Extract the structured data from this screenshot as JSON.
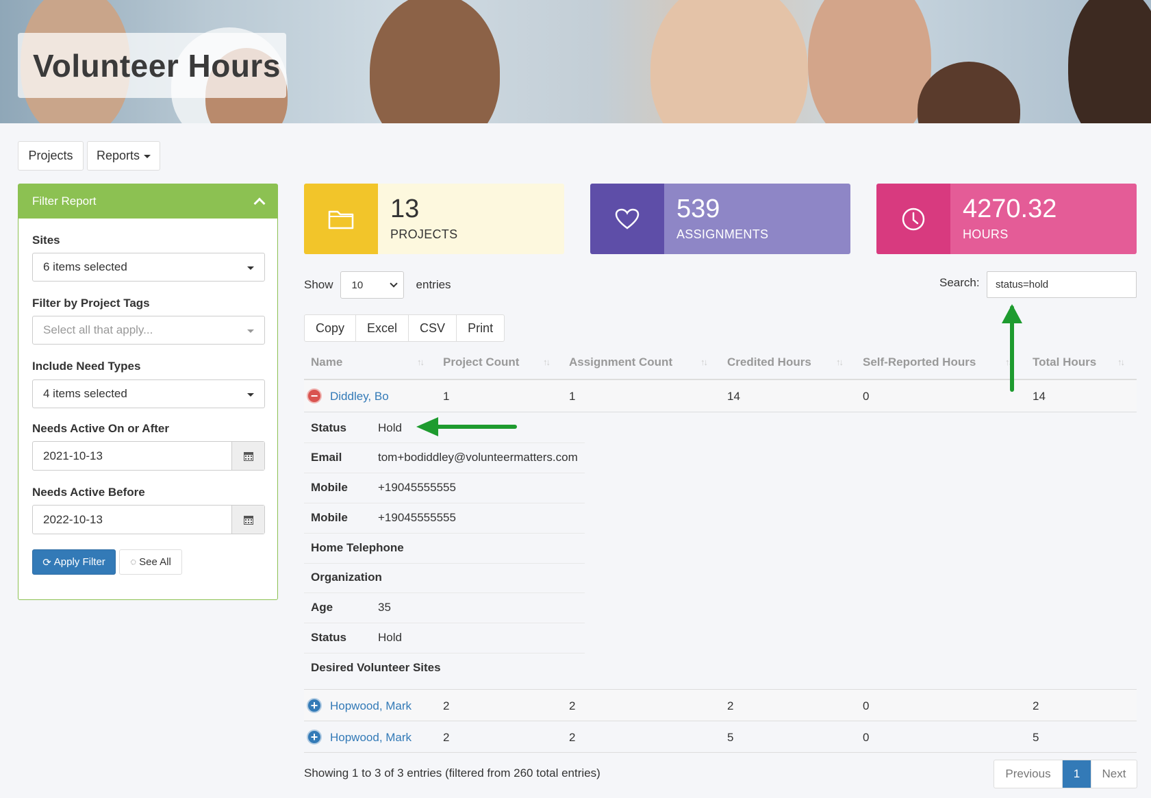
{
  "banner": {
    "title": "Volunteer Hours"
  },
  "nav": {
    "projects": "Projects",
    "reports": "Reports"
  },
  "filter": {
    "title": "Filter Report",
    "sites_label": "Sites",
    "sites_value": "6 items selected",
    "tags_label": "Filter by Project Tags",
    "tags_placeholder": "Select all that apply...",
    "need_types_label": "Include Need Types",
    "need_types_value": "4 items selected",
    "active_after_label": "Needs Active On or After",
    "active_after_value": "2021-10-13",
    "active_before_label": "Needs Active Before",
    "active_before_value": "2022-10-13",
    "apply_label": "Apply Filter",
    "see_all_label": "See All"
  },
  "stats": [
    {
      "value": "13",
      "label": "PROJECTS",
      "icon": "folder-icon",
      "icon_bg": "#f2c52a",
      "body_bg": "#fdf8de",
      "text_color": "#333333"
    },
    {
      "value": "539",
      "label": "ASSIGNMENTS",
      "icon": "heart-icon",
      "icon_bg": "#5e4ea8",
      "body_bg": "#8e86c6",
      "text_color": "#ffffff"
    },
    {
      "value": "4270.32",
      "label": "HOURS",
      "icon": "clock-icon",
      "icon_bg": "#d83a7f",
      "body_bg": "#e45c97",
      "text_color": "#ffffff"
    }
  ],
  "table_controls": {
    "show_label": "Show",
    "length_value": "10",
    "entries_label": "entries",
    "search_label": "Search:",
    "search_value": "status=hold",
    "buttons": [
      "Copy",
      "Excel",
      "CSV",
      "Print"
    ]
  },
  "columns": [
    "Name",
    "Project Count",
    "Assignment Count",
    "Credited Hours",
    "Self-Reported Hours",
    "Total Hours"
  ],
  "rows": [
    {
      "name": "Diddley, Bo",
      "project_count": "1",
      "assignment_count": "1",
      "credited_hours": "14",
      "self_reported_hours": "0",
      "total_hours": "14",
      "expanded": true
    },
    {
      "name": "Hopwood, Mark",
      "project_count": "2",
      "assignment_count": "2",
      "credited_hours": "2",
      "self_reported_hours": "0",
      "total_hours": "2",
      "expanded": false
    },
    {
      "name": "Hopwood, Mark",
      "project_count": "2",
      "assignment_count": "2",
      "credited_hours": "5",
      "self_reported_hours": "0",
      "total_hours": "5",
      "expanded": false
    }
  ],
  "details": [
    {
      "label": "Status",
      "value": "Hold"
    },
    {
      "label": "Email",
      "value": "tom+bodiddley@volunteermatters.com"
    },
    {
      "label": "Mobile",
      "value": "+19045555555"
    },
    {
      "label": "Mobile",
      "value": "+19045555555"
    },
    {
      "label": "Home Telephone",
      "value": ""
    },
    {
      "label": "Organization",
      "value": ""
    },
    {
      "label": "Age",
      "value": "35"
    },
    {
      "label": "Status",
      "value": "Hold"
    },
    {
      "label": "Desired Volunteer Sites",
      "value": ""
    }
  ],
  "footer": {
    "info": "Showing 1 to 3 of 3 entries (filtered from 260 total entries)",
    "previous": "Previous",
    "page": "1",
    "next": "Next"
  },
  "colors": {
    "accent_green": "#8cc152",
    "primary_blue": "#337ab7",
    "annotation_green": "#1e9b2f"
  }
}
